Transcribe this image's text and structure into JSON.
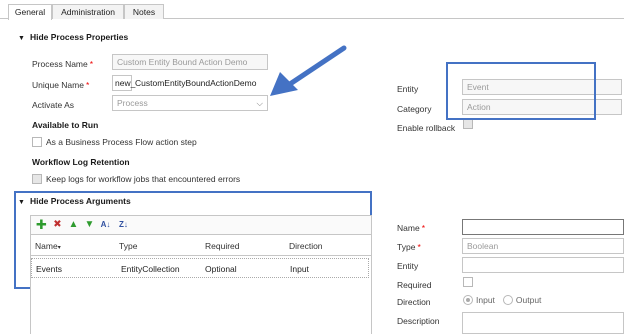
{
  "tabs": [
    {
      "label": "General"
    },
    {
      "label": "Administration"
    },
    {
      "label": "Notes"
    }
  ],
  "properties": {
    "section_title": "Hide Process Properties",
    "process_name_label": "Process Name",
    "process_name_value": "Custom Entity Bound Action Demo",
    "unique_name_label": "Unique Name",
    "unique_name_prefix": "new_",
    "unique_name_value": "CustomEntityBoundActionDemo",
    "activate_as_label": "Activate As",
    "activate_as_value": "Process",
    "available_to_run_title": "Available to Run",
    "bpf_checkbox_label": "As a Business Process Flow action step",
    "log_retention_title": "Workflow Log Retention",
    "keep_logs_label": "Keep logs for workflow jobs that encountered errors",
    "entity_label": "Entity",
    "entity_value": "Event",
    "category_label": "Category",
    "category_value": "Action",
    "enable_rollback_label": "Enable rollback"
  },
  "arguments": {
    "section_title": "Hide Process Arguments",
    "toolbar_icons": [
      "add-icon",
      "delete-icon",
      "move-up-icon",
      "move-down-icon",
      "sort-ascending-icon",
      "sort-descending-icon"
    ],
    "columns": [
      "Name",
      "Type",
      "Required",
      "Direction"
    ],
    "rows": [
      {
        "name": "Events",
        "type": "EntityCollection",
        "required": "Optional",
        "direction": "Input"
      }
    ]
  },
  "arg_detail": {
    "name_label": "Name",
    "name_value": "",
    "type_label": "Type",
    "type_value": "Boolean",
    "entity_label": "Entity",
    "required_label": "Required",
    "direction_label": "Direction",
    "direction_input": "Input",
    "direction_output": "Output",
    "description_label": "Description"
  },
  "colors": {
    "highlight_border": "#4472c4",
    "arrow": "#4472c4",
    "required_marker": "#ee0000"
  }
}
